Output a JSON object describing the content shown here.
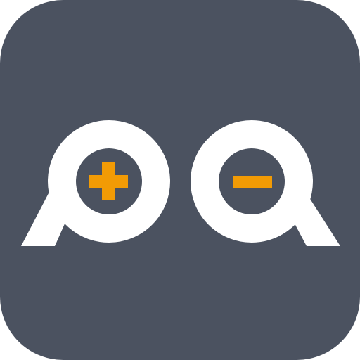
{
  "app_icon": {
    "name": "p+a- logo",
    "colors": {
      "background": "#4B5260",
      "glyph": "#FFFFFF",
      "accent": "#F29B05"
    },
    "glyphs": {
      "left": "p-glyph-icon",
      "right": "a-glyph-icon",
      "plus": "plus-icon",
      "minus": "minus-icon"
    }
  }
}
